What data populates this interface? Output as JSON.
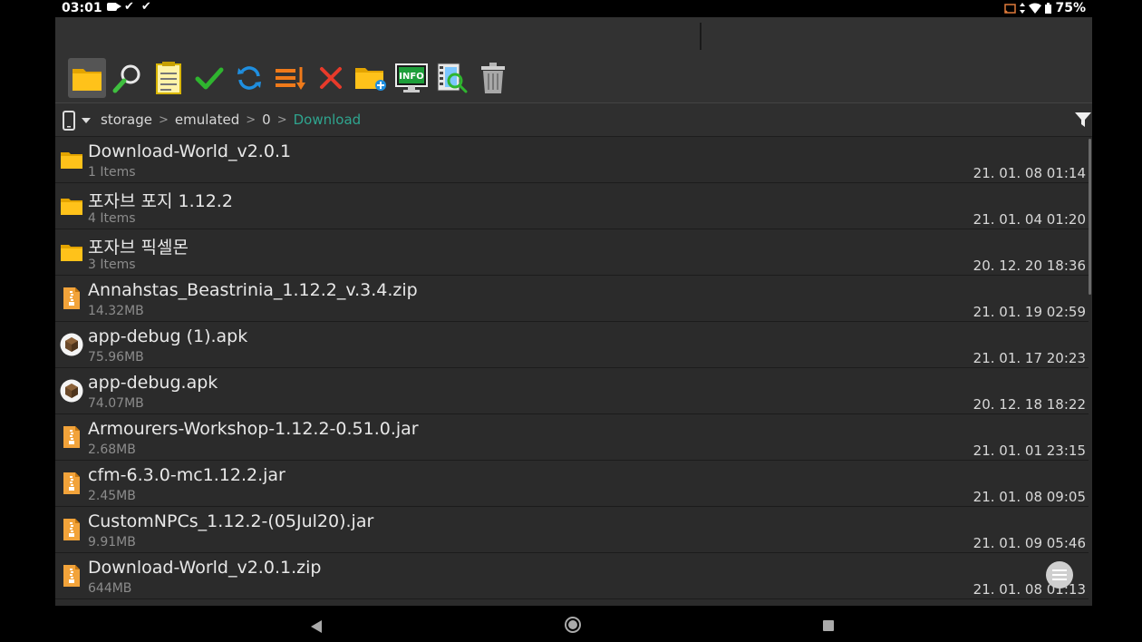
{
  "status_bar": {
    "time": "03:01",
    "battery": "75%"
  },
  "path": {
    "crumbs": [
      {
        "label": "storage"
      },
      {
        "label": "emulated"
      },
      {
        "label": "0"
      },
      {
        "label": "Download"
      }
    ]
  },
  "files": [
    {
      "name": "Download-World_v2.0.1",
      "meta": "1 Items",
      "date": "21. 01. 08 01:14",
      "type": "folder"
    },
    {
      "name": "포자브 포지 1.12.2",
      "meta": "4 Items",
      "date": "21. 01. 04 01:20",
      "type": "folder"
    },
    {
      "name": "포자브 픽셀몬",
      "meta": "3 Items",
      "date": "20. 12. 20 18:36",
      "type": "folder"
    },
    {
      "name": "Annahstas_Beastrinia_1.12.2_v.3.4.zip",
      "meta": "14.32MB",
      "date": "21. 01. 19 02:59",
      "type": "archive"
    },
    {
      "name": "app-debug (1).apk",
      "meta": "75.96MB",
      "date": "21. 01. 17 20:23",
      "type": "apk"
    },
    {
      "name": "app-debug.apk",
      "meta": "74.07MB",
      "date": "20. 12. 18 18:22",
      "type": "apk"
    },
    {
      "name": "Armourers-Workshop-1.12.2-0.51.0.jar",
      "meta": "2.68MB",
      "date": "21. 01. 01 23:15",
      "type": "archive"
    },
    {
      "name": "cfm-6.3.0-mc1.12.2.jar",
      "meta": "2.45MB",
      "date": "21. 01. 08 09:05",
      "type": "archive"
    },
    {
      "name": "CustomNPCs_1.12.2-(05Jul20).jar",
      "meta": "9.91MB",
      "date": "21. 01. 09 05:46",
      "type": "archive"
    },
    {
      "name": "Download-World_v2.0.1.zip",
      "meta": "644MB",
      "date": "21. 01. 08 01:13",
      "type": "archive"
    }
  ]
}
